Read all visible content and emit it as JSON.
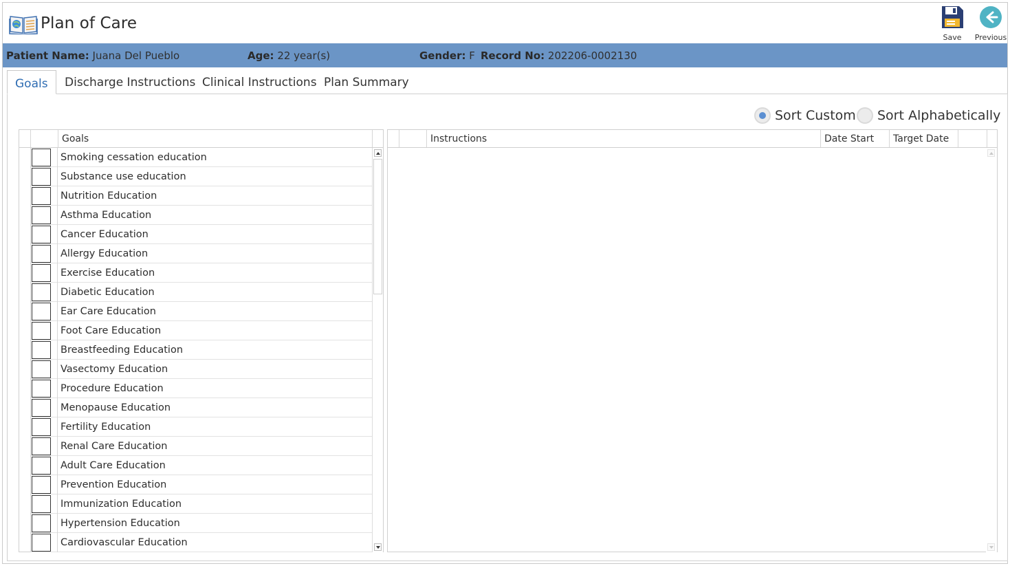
{
  "app": {
    "title": "Plan of Care",
    "icon": "book-globe-icon"
  },
  "toolbar": {
    "save_label": "Save",
    "previous_label": "Previous"
  },
  "patient": {
    "name_label": "Patient Name:",
    "name": "Juana Del Pueblo",
    "age_label": "Age:",
    "age": "22 year(s)",
    "gender_label": "Gender:",
    "gender": "F",
    "record_label": "Record No:",
    "record": "202206-0002130"
  },
  "tabs": [
    {
      "label": "Goals",
      "active": true
    },
    {
      "label": "Discharge Instructions",
      "active": false
    },
    {
      "label": "Clinical Instructions",
      "active": false
    },
    {
      "label": "Plan Summary",
      "active": false
    }
  ],
  "sort": {
    "custom_label": "Sort Custom",
    "alpha_label": "Sort Alphabetically",
    "selected": "custom"
  },
  "goals_grid": {
    "header": "Goals",
    "rows": [
      "Smoking cessation education",
      "Substance use education",
      "Nutrition Education",
      "Asthma Education",
      "Cancer Education",
      "Allergy Education",
      "Exercise Education",
      "Diabetic Education",
      "Ear Care Education",
      "Foot Care Education",
      "Breastfeeding Education",
      "Vasectomy Education",
      "Procedure Education",
      "Menopause Education",
      "Fertility Education",
      "Renal Care Education",
      "Adult Care Education",
      "Prevention Education",
      "Immunization Education",
      "Hypertension Education",
      "Cardiovascular Education"
    ]
  },
  "instructions_grid": {
    "headers": {
      "instructions": "Instructions",
      "date_start": "Date Start",
      "target_date": "Target Date"
    }
  },
  "colors": {
    "patient_bar": "#6b95c6",
    "active_tab": "#2f6db3",
    "radio_dot": "#5b8fd2",
    "save_icon": "#2b3f73",
    "previous_icon": "#4fb3c4"
  }
}
